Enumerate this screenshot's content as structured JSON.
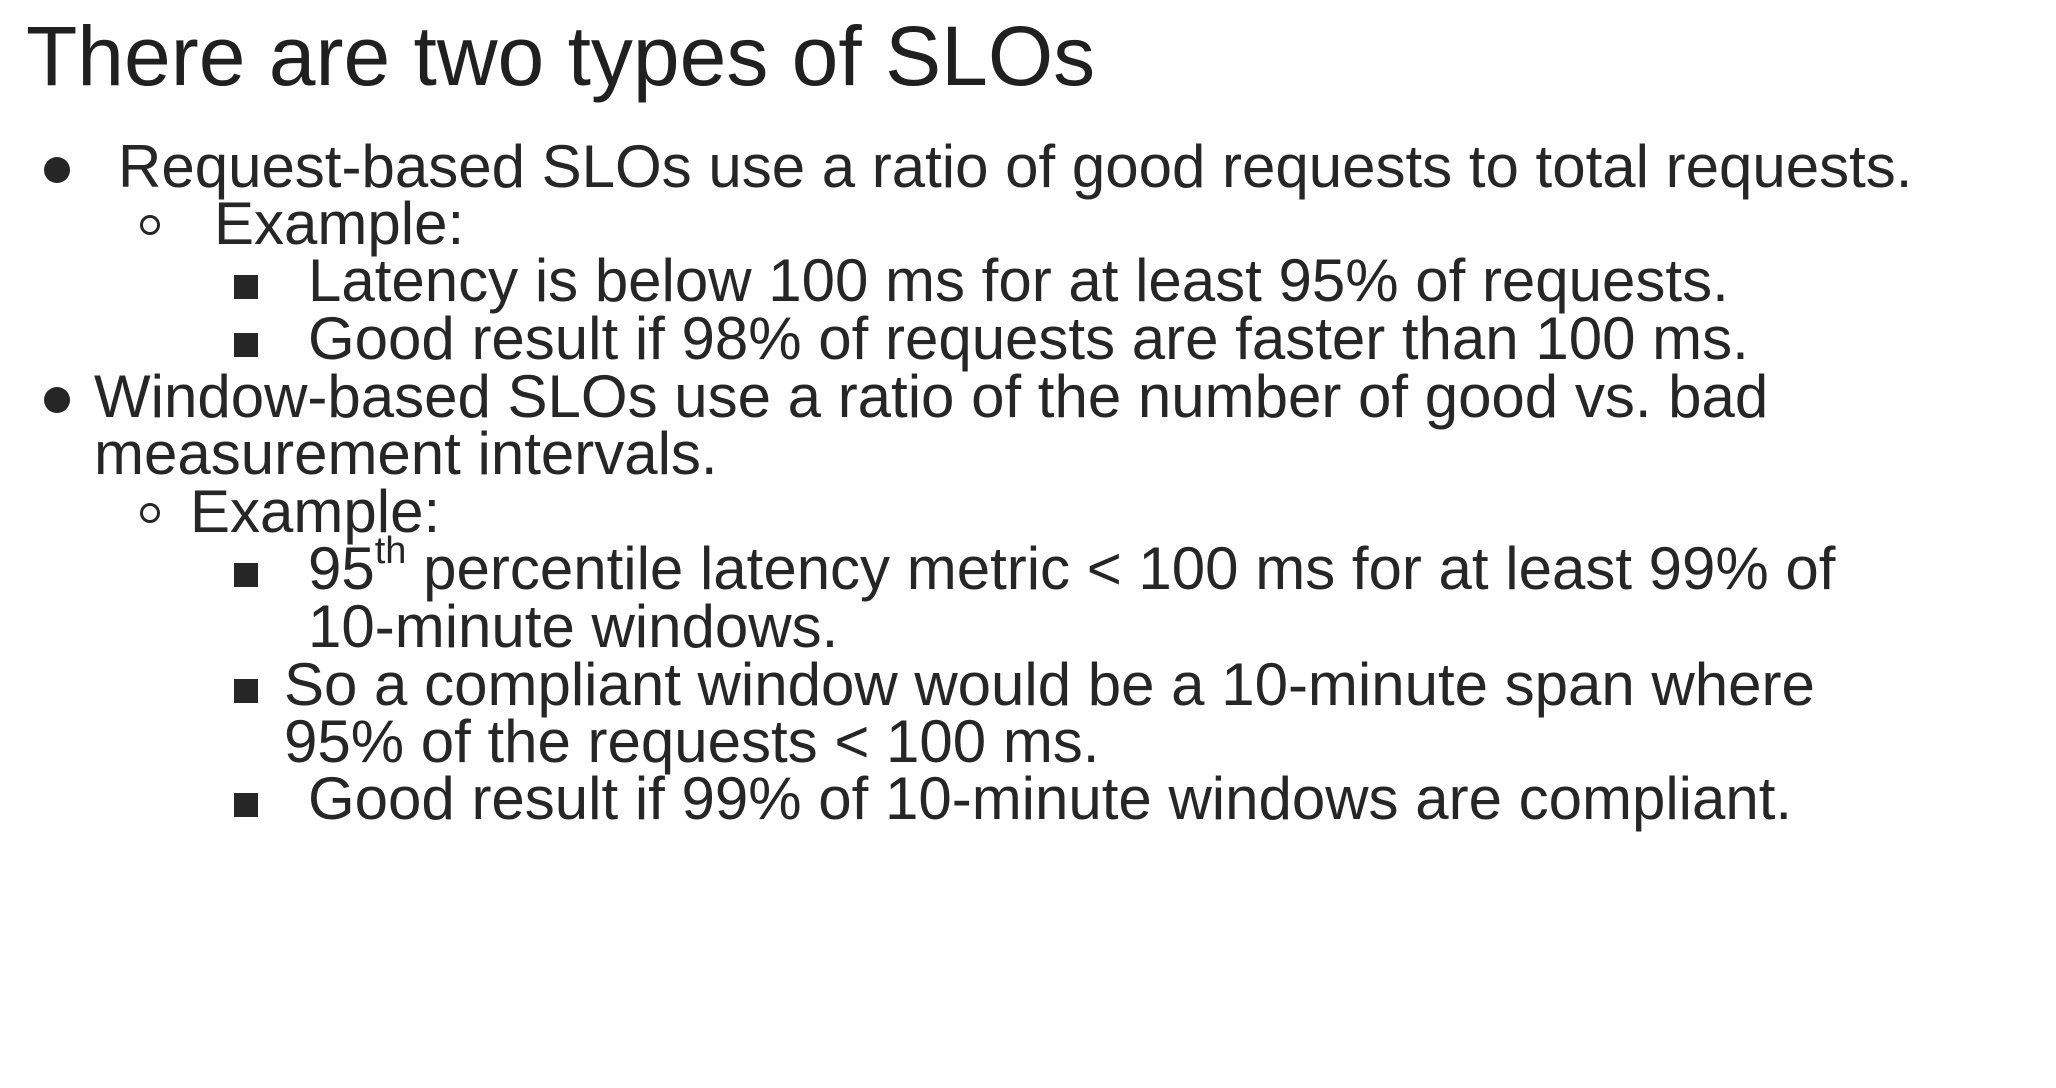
{
  "slide": {
    "title": "There are two types of SLOs",
    "bullets": [
      {
        "text": "Request-based SLOs use a ratio of good requests to total requests.",
        "sub_label": "Example:",
        "sub_items": [
          "Latency is below 100 ms for at least 95% of requests.",
          "Good result if 98% of requests are faster than 100 ms."
        ]
      },
      {
        "text_line1": "Window-based SLOs use a ratio of the number of good vs. bad",
        "text_line2": "measurement intervals.",
        "sub_label": "Example:",
        "sub_items": [
          {
            "prefix": "95",
            "superscript": "th",
            "rest_line1": " percentile latency metric < 100 ms for at least 99% of",
            "rest_line2": "10-minute windows."
          },
          {
            "line1": "So a compliant window would be a 10-minute span where",
            "line2": "95% of the requests < 100 ms."
          },
          "Good result if 99% of 10-minute windows are compliant."
        ]
      }
    ]
  }
}
